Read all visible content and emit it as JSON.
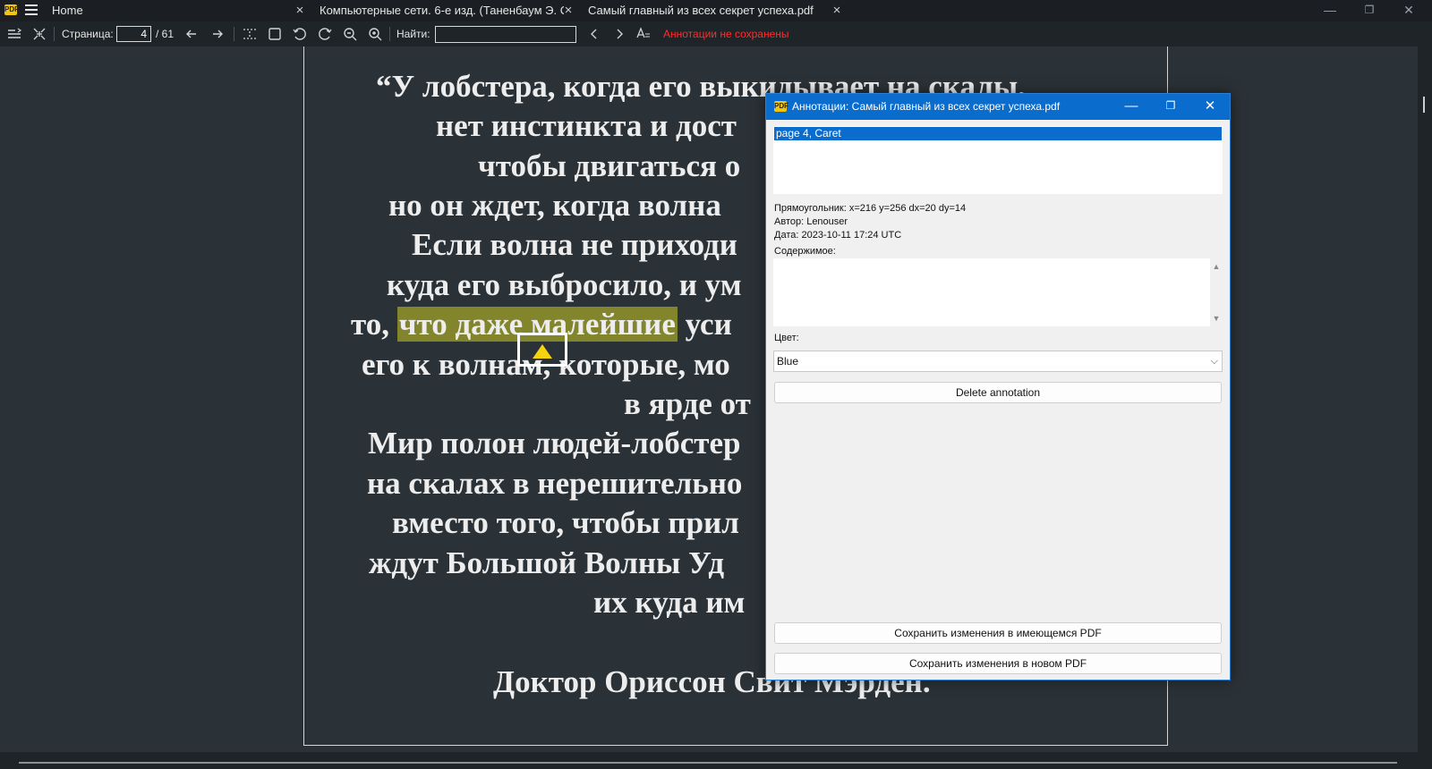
{
  "tabs": [
    {
      "label": "Home"
    },
    {
      "label": "Компьютерные сети. 6-е изд. (Таненбаум Э. С..."
    },
    {
      "label": "Самый главный из всех секрет успеха.pdf"
    }
  ],
  "window_controls": {
    "minimize": "—",
    "maximize": "❐",
    "close": "✕"
  },
  "toolbar": {
    "page_label": "Страница:",
    "page_value": "4",
    "page_total": "/ 61",
    "find_label": "Найти:",
    "find_value": "",
    "unsaved_notice": "Аннотации не сохранены"
  },
  "document": {
    "lines": [
      "“У лобстера, когда его выкидывает на скалы,",
      "нет инстинкта и дост",
      "чтобы двигаться о",
      "но он ждет, когда волна",
      "Если волна не приходи",
      "куда его выбросило, и ум",
      "его к волнам, которые, мо",
      "в ярде от",
      "Мир полон людей-лобстер",
      "на скалах в нерешительно",
      "вместо того, чтобы прил",
      "ждут Большой Волны Уд",
      "их куда им",
      "Доктор Ориссон Свит Мэрден."
    ],
    "line7_prefix": "то, ",
    "line7_highlight": "что даже малейшие",
    "line7_suffix": " уси"
  },
  "dialog": {
    "title": "Аннотации: Самый главный из всех секрет успеха.pdf",
    "list_items": [
      "page 4, Caret"
    ],
    "rect_info": "Прямоугольник: x=216 y=256 dx=20 dy=14",
    "author": "Автор: Lenouser",
    "date": "Дата: 2023-10-11 17:24 UTC",
    "contents_label": "Содержимое:",
    "contents_value": "",
    "color_label": "Цвет:",
    "color_value": "Blue",
    "delete_button": "Delete annotation",
    "save_existing_button": "Сохранить изменения в имеющемся PDF",
    "save_new_button": "Сохранить изменения в новом PDF"
  },
  "colors": {
    "accent": "#0a6ccd",
    "highlight": "#a8a828",
    "caret": "#f5d30f",
    "unsaved": "#ff2d2d"
  }
}
